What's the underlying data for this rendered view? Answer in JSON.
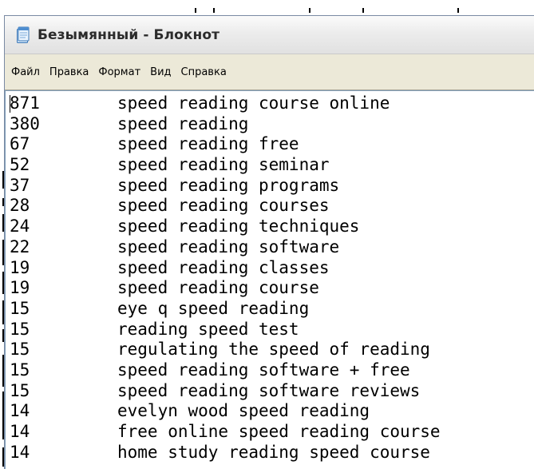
{
  "window": {
    "title": "Безымянный - Блокнот",
    "icon": "notepad-icon"
  },
  "menu": {
    "items": [
      "Файл",
      "Правка",
      "Формат",
      "Вид",
      "Справка"
    ]
  },
  "editor": {
    "lines": [
      {
        "count": "871",
        "phrase": "speed reading course online"
      },
      {
        "count": "380",
        "phrase": "speed reading"
      },
      {
        "count": "67",
        "phrase": "speed reading free"
      },
      {
        "count": "52",
        "phrase": "speed reading seminar"
      },
      {
        "count": "37",
        "phrase": "speed reading programs"
      },
      {
        "count": "28",
        "phrase": "speed reading courses"
      },
      {
        "count": "24",
        "phrase": "speed reading techniques"
      },
      {
        "count": "22",
        "phrase": "speed reading software"
      },
      {
        "count": "19",
        "phrase": "speed reading classes"
      },
      {
        "count": "19",
        "phrase": "speed reading course"
      },
      {
        "count": "15",
        "phrase": "eye q speed reading"
      },
      {
        "count": "15",
        "phrase": "reading speed test"
      },
      {
        "count": "15",
        "phrase": "regulating the speed of reading"
      },
      {
        "count": "15",
        "phrase": "speed reading software + free"
      },
      {
        "count": "15",
        "phrase": "speed reading software reviews"
      },
      {
        "count": "14",
        "phrase": "evelyn wood speed reading"
      },
      {
        "count": "14",
        "phrase": "free online speed reading course"
      },
      {
        "count": "14",
        "phrase": "home study reading speed course"
      }
    ]
  },
  "colors": {
    "menubar_bg": "#ece9d8",
    "editor_bg": "#ffffff",
    "text": "#000000"
  }
}
